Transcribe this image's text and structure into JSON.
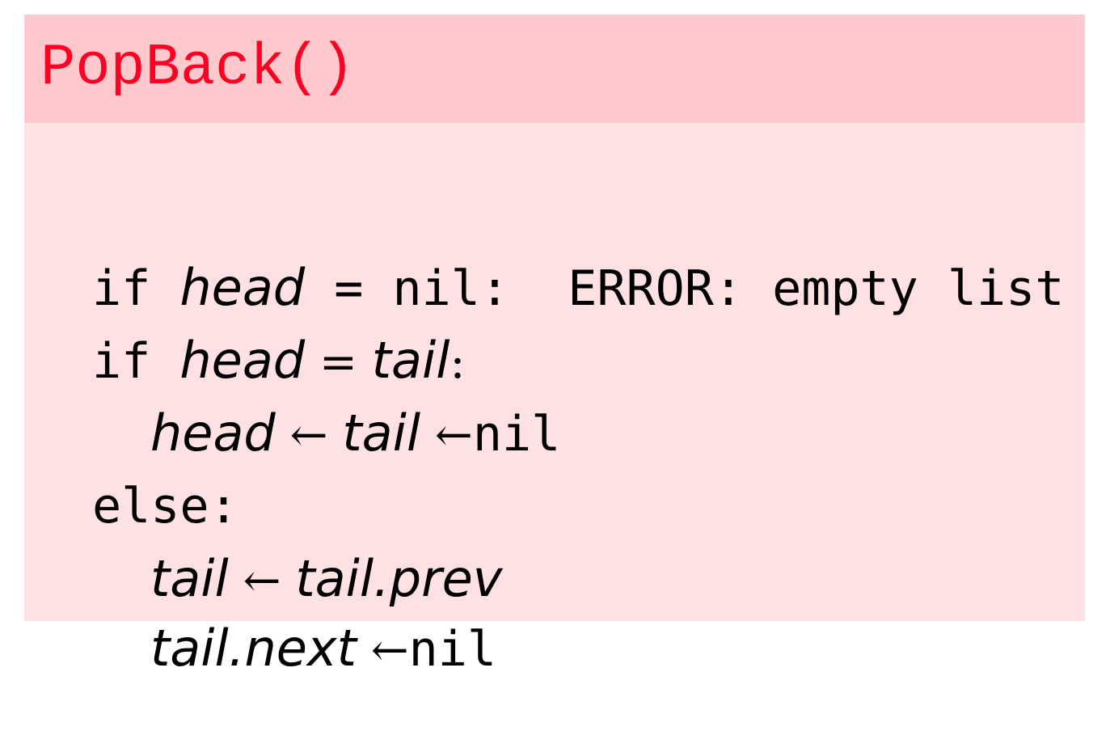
{
  "title": "PopBack()",
  "lines": [
    {
      "kw_if": "if",
      "var_head": "head",
      "op_eq": "=",
      "nil": "nil:",
      "error": "ERROR: empty list"
    },
    {
      "kw_if": "if",
      "var_head": "head",
      "op_eq": "=",
      "var_tail": "tail",
      "colon": ":"
    },
    {
      "var_head": "head",
      "arrow1": "←",
      "var_tail": "tail",
      "arrow2": "←",
      "nil": "nil"
    },
    {
      "kw_else": "else:"
    },
    {
      "var_tail": "tail",
      "arrow": "←",
      "var_tail_prev": "tail.prev"
    },
    {
      "var_tail_next": "tail.next",
      "arrow": "←",
      "nil": "nil"
    }
  ]
}
